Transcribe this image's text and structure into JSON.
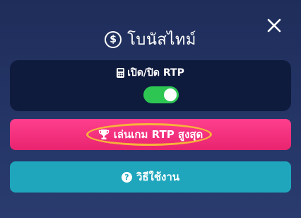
{
  "modal": {
    "title": "โบนัสไทม์",
    "title_icon": "coin-dollar-icon",
    "title_icon_glyph": "$",
    "close_icon": "close-icon"
  },
  "rtp_panel": {
    "label": "เปิด/ปิด RTP",
    "label_icon": "calculator-icon",
    "toggle_on": true,
    "toggle_color": "#2dc653"
  },
  "buttons": {
    "play_label": "เล่นเกม RTP สูงสุด",
    "play_icon": "trophy-icon",
    "play_color": "#ff3f8e",
    "howto_label": "วิธีใช้งาน",
    "howto_icon": "help-icon",
    "howto_icon_glyph": "?",
    "howto_color": "#1fa6bd"
  },
  "highlight_color": "#f7b43a"
}
